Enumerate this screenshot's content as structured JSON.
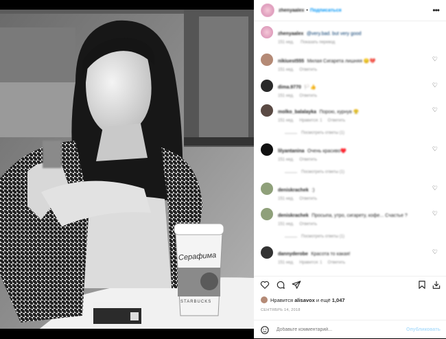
{
  "post": {
    "author": "zhenyaalex",
    "follow_label": "Подписаться",
    "more_icon": "more-horizontal-icon"
  },
  "caption": {
    "author": "zhenyaalex",
    "text": "@very.bad. but very good",
    "time": "151 нед.",
    "translate_label": "Показать перевод"
  },
  "comments": [
    {
      "user": "nikiuest555",
      "text": "Милая Сигарета лишняя 😔💔",
      "time": "151 нед.",
      "reply": "Ответить",
      "likes": ""
    },
    {
      "user": "dima.9770",
      "text": "🏳️👍",
      "time": "151 нед.",
      "reply": "Ответить",
      "likes": ""
    },
    {
      "user": "molko_balalayka",
      "text": "Порою, курнув 😤",
      "time": "151 нед.",
      "likes": "Нравится: 1",
      "reply": "Ответить",
      "view_replies": "Посмотреть ответы (1)"
    },
    {
      "user": "lilyantanina",
      "text": "Очень красиво♥️",
      "time": "151 нед.",
      "reply": "Ответить",
      "view_replies": "Посмотреть ответы (1)"
    },
    {
      "user": "deniskrachek",
      "text": ":)",
      "time": "151 нед.",
      "reply": "Ответить",
      "likes": ""
    },
    {
      "user": "deniskrachek",
      "text": "Просыпа, утро, сигарету, кофе... Счастье ?",
      "time": "151 нед.",
      "reply": "Ответить",
      "view_replies": "Посмотреть ответы (1)"
    },
    {
      "user": "dannyderobe",
      "text": "Красота то какая!",
      "time": "151 нед.",
      "likes": "Нравится: 1",
      "reply": "Ответить"
    }
  ],
  "likes": {
    "prefix": "Нравится",
    "user": "alisavox",
    "suffix": "и ещё",
    "count": "1,047"
  },
  "date": "СЕНТЯБРЬ 14, 2018",
  "comment_box": {
    "placeholder": "Добавьте комментарий...",
    "post_label": "Опубликовать"
  },
  "photo": {
    "cup_text": "Серафима",
    "cup_brand": "STARBUCKS"
  }
}
